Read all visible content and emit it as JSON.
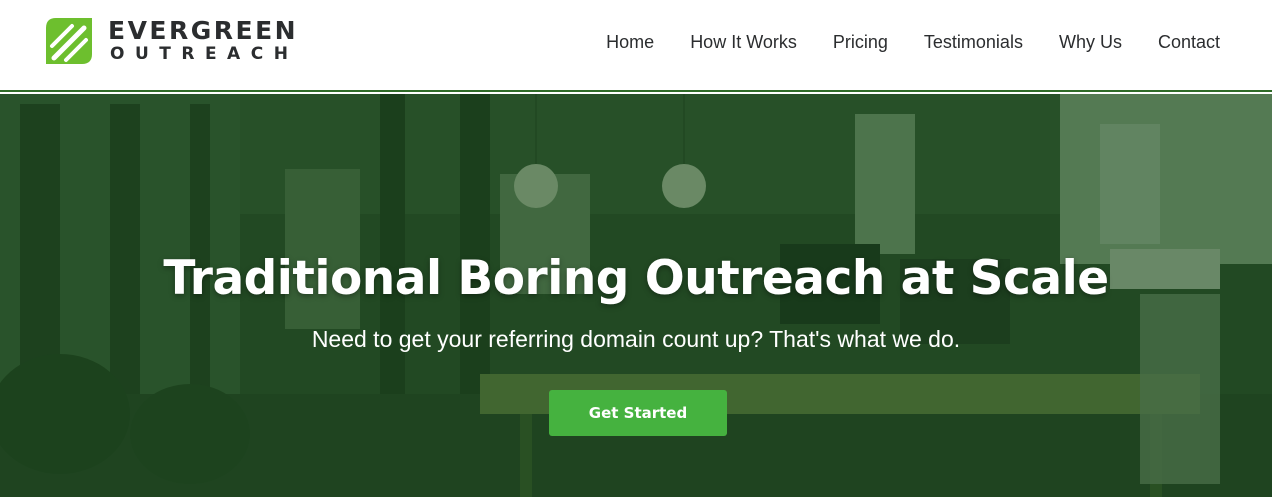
{
  "brand": {
    "name_top": "EVERGREEN",
    "name_bottom": "OUTREACH",
    "icon": "leaf-logo-icon",
    "logo_color": "#6dbf2e"
  },
  "nav": {
    "items": [
      {
        "label": "Home"
      },
      {
        "label": "How It Works"
      },
      {
        "label": "Pricing"
      },
      {
        "label": "Testimonials"
      },
      {
        "label": "Why Us"
      },
      {
        "label": "Contact"
      }
    ]
  },
  "hero": {
    "title": "Traditional Boring Outreach at Scale",
    "subtitle": "Need to get your referring domain count up? That's what we do.",
    "cta_label": "Get Started",
    "cta_color": "#45b23f",
    "overlay_color": "#1c481e",
    "background_image": "office-interior-photo"
  }
}
